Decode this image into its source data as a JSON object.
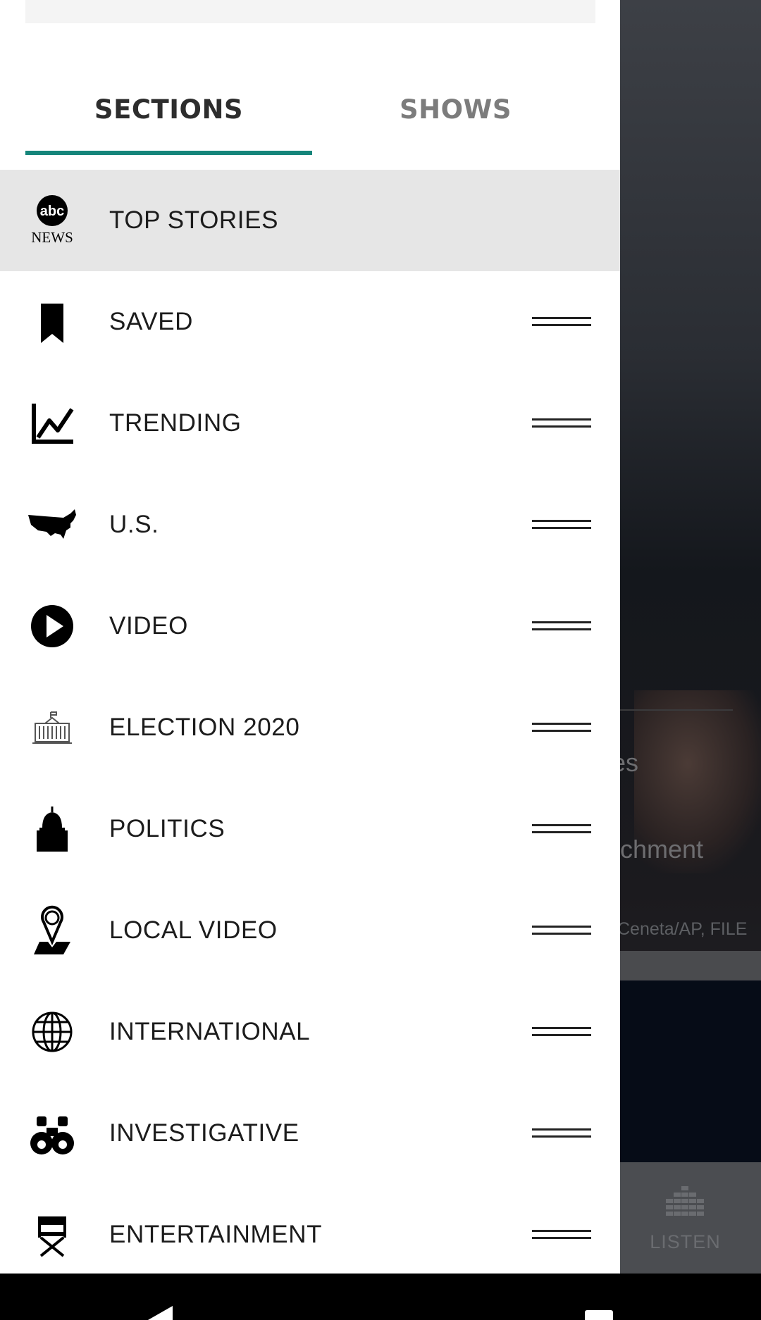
{
  "background": {
    "story_fragment_1": "es",
    "story_fragment_2": "chment",
    "photo_credit": "Ceneta/AP, FILE",
    "tab_listen_label": "LISTEN"
  },
  "drawer": {
    "tabs": [
      {
        "label": "SECTIONS",
        "selected": true
      },
      {
        "label": "SHOWS",
        "selected": false
      }
    ],
    "accent_color": "#15857a",
    "sections": [
      {
        "label": "TOP STORIES",
        "icon": "abc-news-logo",
        "active": true
      },
      {
        "label": "SAVED",
        "icon": "bookmark-icon"
      },
      {
        "label": "TRENDING",
        "icon": "trending-chart-icon"
      },
      {
        "label": "U.S.",
        "icon": "us-map-icon"
      },
      {
        "label": "VIDEO",
        "icon": "play-circle-icon"
      },
      {
        "label": "ELECTION 2020",
        "icon": "white-house-icon"
      },
      {
        "label": "POLITICS",
        "icon": "capitol-icon"
      },
      {
        "label": "LOCAL VIDEO",
        "icon": "map-pin-icon"
      },
      {
        "label": "INTERNATIONAL",
        "icon": "globe-icon"
      },
      {
        "label": "INVESTIGATIVE",
        "icon": "binoculars-icon"
      },
      {
        "label": "ENTERTAINMENT",
        "icon": "director-chair-icon"
      }
    ]
  },
  "logo": {
    "line1": "abc",
    "line2": "NEWS"
  }
}
